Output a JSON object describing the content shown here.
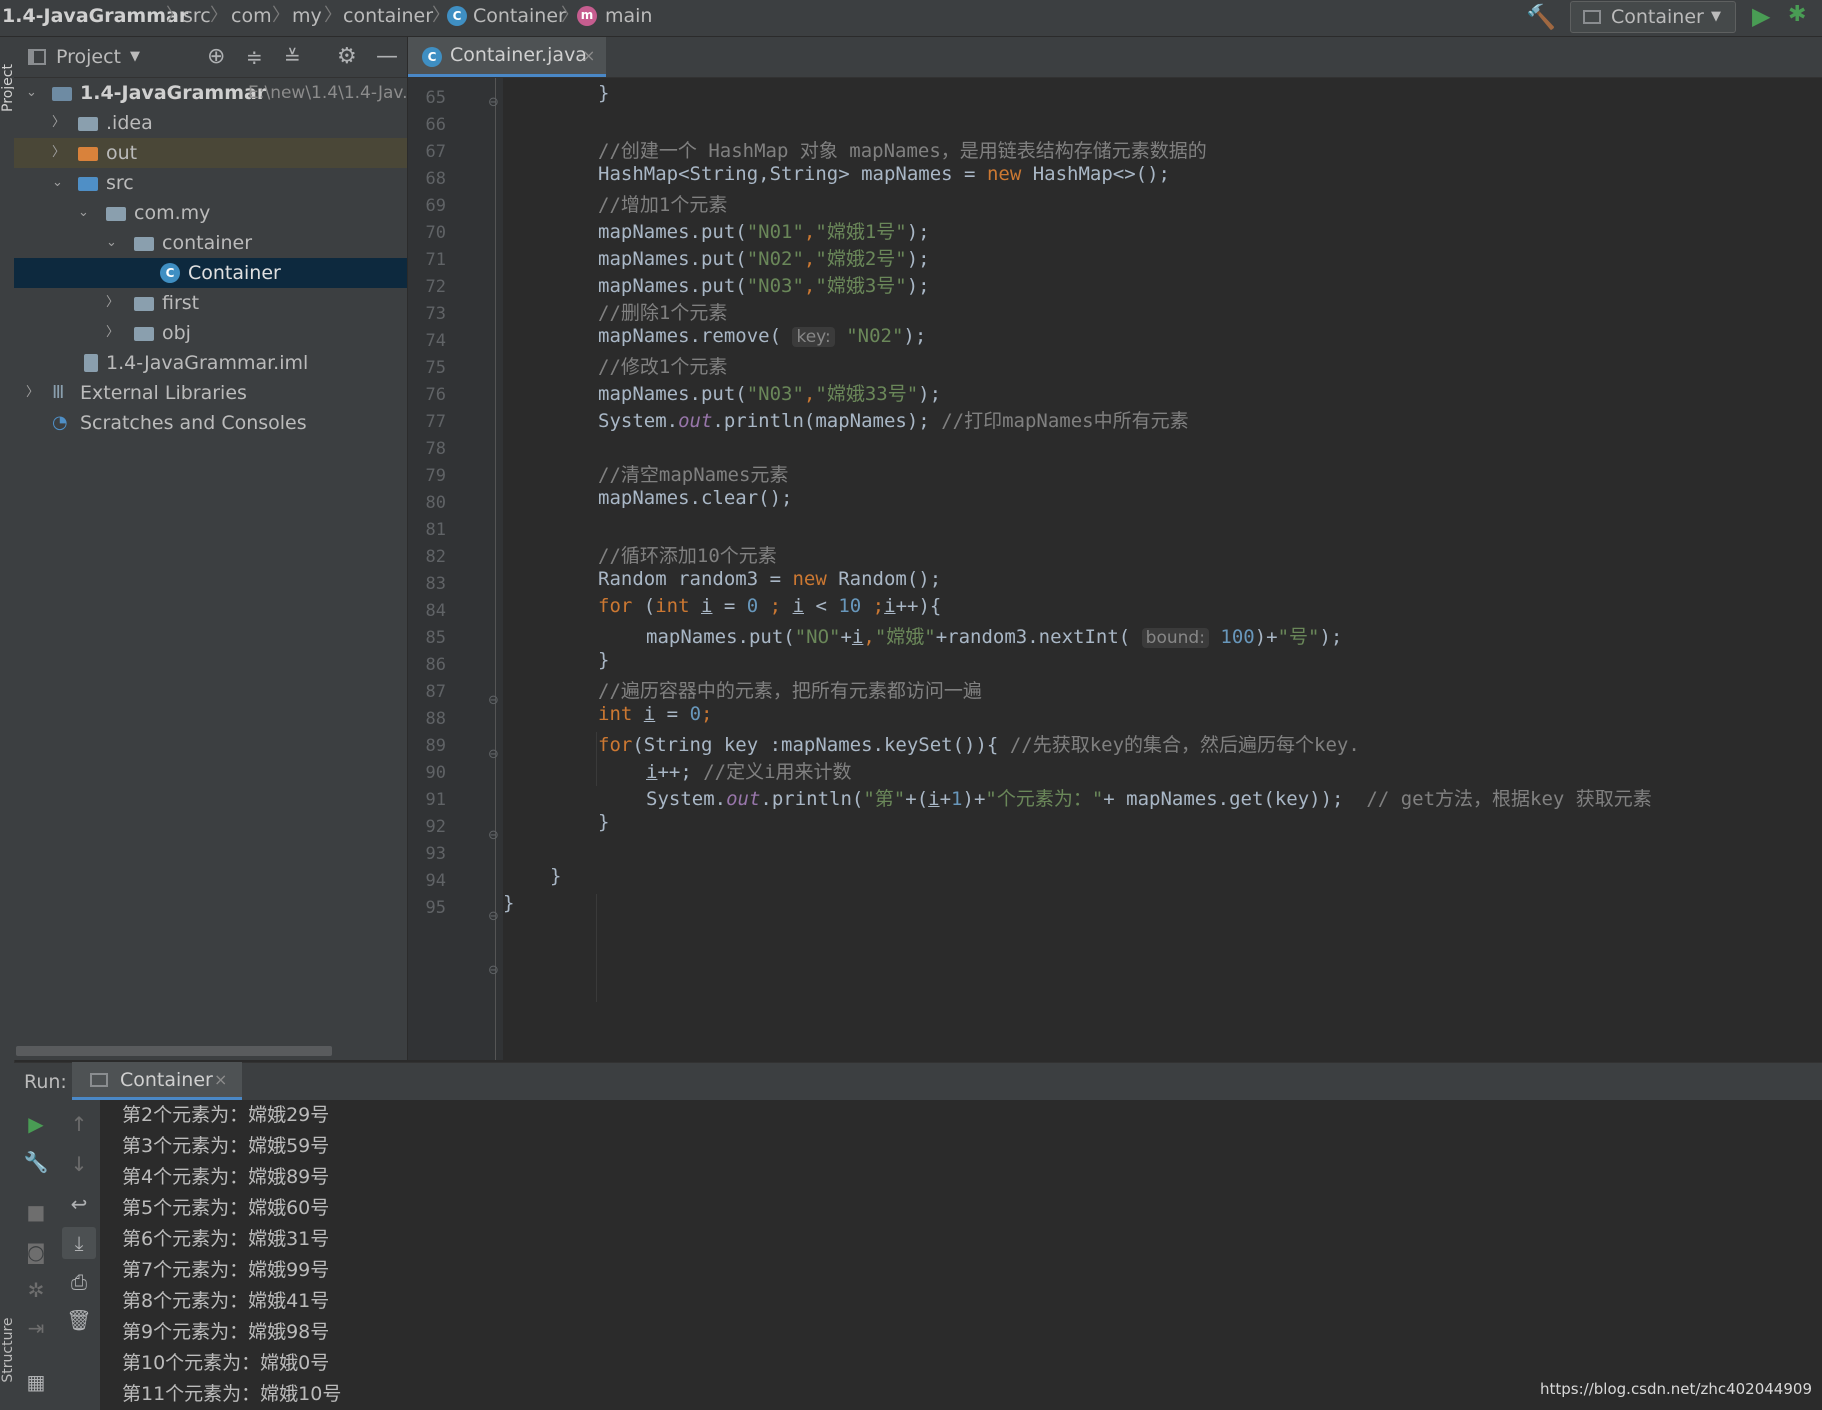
{
  "breadcrumb": {
    "project": "1.4-JavaGrammar",
    "items": [
      "src",
      "com",
      "my",
      "container"
    ],
    "class_name": "Container",
    "method": "main",
    "class_badge": "C",
    "method_badge": "m"
  },
  "toolbar": {
    "run_config": "Container"
  },
  "side_tabs": {
    "project": "Project",
    "structure": "Structure"
  },
  "project_panel": {
    "title": "Project"
  },
  "tree": {
    "root": {
      "label": "1.4-JavaGrammar",
      "path": "E:\\new\\1.4\\1.4-Jav..."
    },
    "idea": ".idea",
    "out": "out",
    "src": "src",
    "com_my": "com.my",
    "container_pkg": "container",
    "container_class": "Container",
    "first": "first",
    "obj": "obj",
    "iml": "1.4-JavaGrammar.iml",
    "ext_libs": "External Libraries",
    "scratches": "Scratches and Consoles"
  },
  "editor_tab": {
    "filename": "Container.java",
    "close": "×"
  },
  "editor": {
    "line_numbers": [
      "65",
      "66",
      "67",
      "68",
      "69",
      "70",
      "71",
      "72",
      "73",
      "74",
      "75",
      "76",
      "77",
      "78",
      "79",
      "80",
      "81",
      "82",
      "83",
      "84",
      "85",
      "86",
      "87",
      "88",
      "89",
      "90",
      "91",
      "92",
      "93",
      "94",
      "95"
    ],
    "code": {
      "l65": "}",
      "l67": "//创建一个 HashMap 对象 mapNames，是用链表结构存储元素数据的",
      "l68a": "HashMap<String,String> mapNames = ",
      "l68b": "new",
      "l68c": " HashMap<>();",
      "l69": "//增加1个元素",
      "put": "mapNames.put(",
      "n01": "\"N01\"",
      "n02": "\"N02\"",
      "n03": "\"N03\"",
      "comma": ",",
      "v1": "\"嫦娥1号\"",
      "v2": "\"嫦娥2号\"",
      "v3": "\"嫦娥3号\"",
      "v33": "\"嫦娥33号\"",
      "close": ");",
      "l73": "//删除1个元素",
      "l74a": "mapNames.remove(",
      "hint_key": "key:",
      "l75": "//修改1个元素",
      "l77a": "System.",
      "out": "out",
      "l77b": ".println(mapNames); ",
      "l77c": "//打印mapNames中所有元素",
      "l79": "//清空mapNames元素",
      "l80": "mapNames.clear();",
      "l82": "//循环添加10个元素",
      "l83a": "Random random3 = ",
      "l83b": " Random();",
      "for": "for",
      "int": "int",
      "i": "i",
      "l84a": " (",
      "l84b": " = ",
      "zero": "0",
      "l84c": " ; ",
      "l84d": " < ",
      "ten": "10",
      "l84e": " ;",
      "l84f": "++){",
      "no": "\"NO\"",
      "plus": "+",
      "change": "\"嫦娥\"",
      "l85a": "+random3.nextInt(",
      "hint_bound": "bound:",
      "hundred": "100",
      "l85b": ")+",
      "hao": "\"号\"",
      "brace": "}",
      "l87": "//遍历容器中的元素，把所有元素都访问一遍",
      "l88b": " = ",
      "semi": ";",
      "l89a": "(String key :mapNames.keySet()){ ",
      "l89b": "//先获取key的集合，然后遍历每个key.",
      "l90a": "++; ",
      "l90b": "//定义i用来计数",
      "di": "\"第\"",
      "l91a": "+(",
      "one": "1",
      "l91b": ")+",
      "ge": "\"个元素为：\"",
      "l91c": "+ mapNames.get(key));  ",
      "l91d": "// get方法，根据key 获取元素"
    }
  },
  "run_panel": {
    "label": "Run:",
    "tab": "Container",
    "close": "×",
    "output": [
      "第2个元素为：嫦娥29号",
      "第3个元素为：嫦娥59号",
      "第4个元素为：嫦娥89号",
      "第5个元素为：嫦娥60号",
      "第6个元素为：嫦娥31号",
      "第7个元素为：嫦娥99号",
      "第8个元素为：嫦娥41号",
      "第9个元素为：嫦娥98号",
      "第10个元素为：嫦娥0号",
      "第11个元素为：嫦娥10号"
    ]
  },
  "watermark": "https://blog.csdn.net/zhc402044909",
  "colors": {
    "keyword": "#cc7832",
    "string": "#6a8759",
    "number": "#6897bb",
    "comment": "#808080",
    "field": "#9876aa",
    "selection": "#0d293e",
    "accent": "#4a88c7",
    "run_green": "#499c54"
  }
}
